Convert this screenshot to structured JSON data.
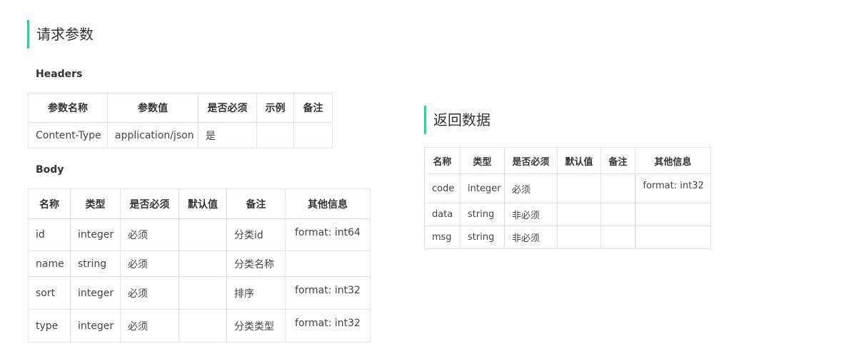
{
  "request": {
    "title": "请求参数",
    "headers_label": "Headers",
    "headers_table": {
      "columns": [
        "参数名称",
        "参数值",
        "是否必须",
        "示例",
        "备注"
      ],
      "rows": [
        [
          "Content-Type",
          "application/json",
          "是",
          "",
          ""
        ]
      ]
    },
    "body_label": "Body",
    "body_table": {
      "columns": [
        "名称",
        "类型",
        "是否必须",
        "默认值",
        "备注",
        "其他信息"
      ],
      "rows": [
        [
          "id",
          "integer",
          "必须",
          "",
          "分类id",
          "format: int64"
        ],
        [
          "name",
          "string",
          "必须",
          "",
          "分类名称",
          ""
        ],
        [
          "sort",
          "integer",
          "必须",
          "",
          "排序",
          "format: int32"
        ],
        [
          "type",
          "integer",
          "必须",
          "",
          "分类类型",
          "format: int32"
        ]
      ]
    }
  },
  "response": {
    "title": "返回数据",
    "table": {
      "columns": [
        "名称",
        "类型",
        "是否必须",
        "默认值",
        "备注",
        "其他信息"
      ],
      "rows": [
        [
          "code",
          "integer",
          "必须",
          "",
          "",
          "format: int32"
        ],
        [
          "data",
          "string",
          "非必须",
          "",
          "",
          ""
        ],
        [
          "msg",
          "string",
          "非必须",
          "",
          "",
          ""
        ]
      ]
    }
  },
  "colors": {
    "accent": "#42c88f",
    "border": "#e2e2e2",
    "text": "#333333"
  }
}
